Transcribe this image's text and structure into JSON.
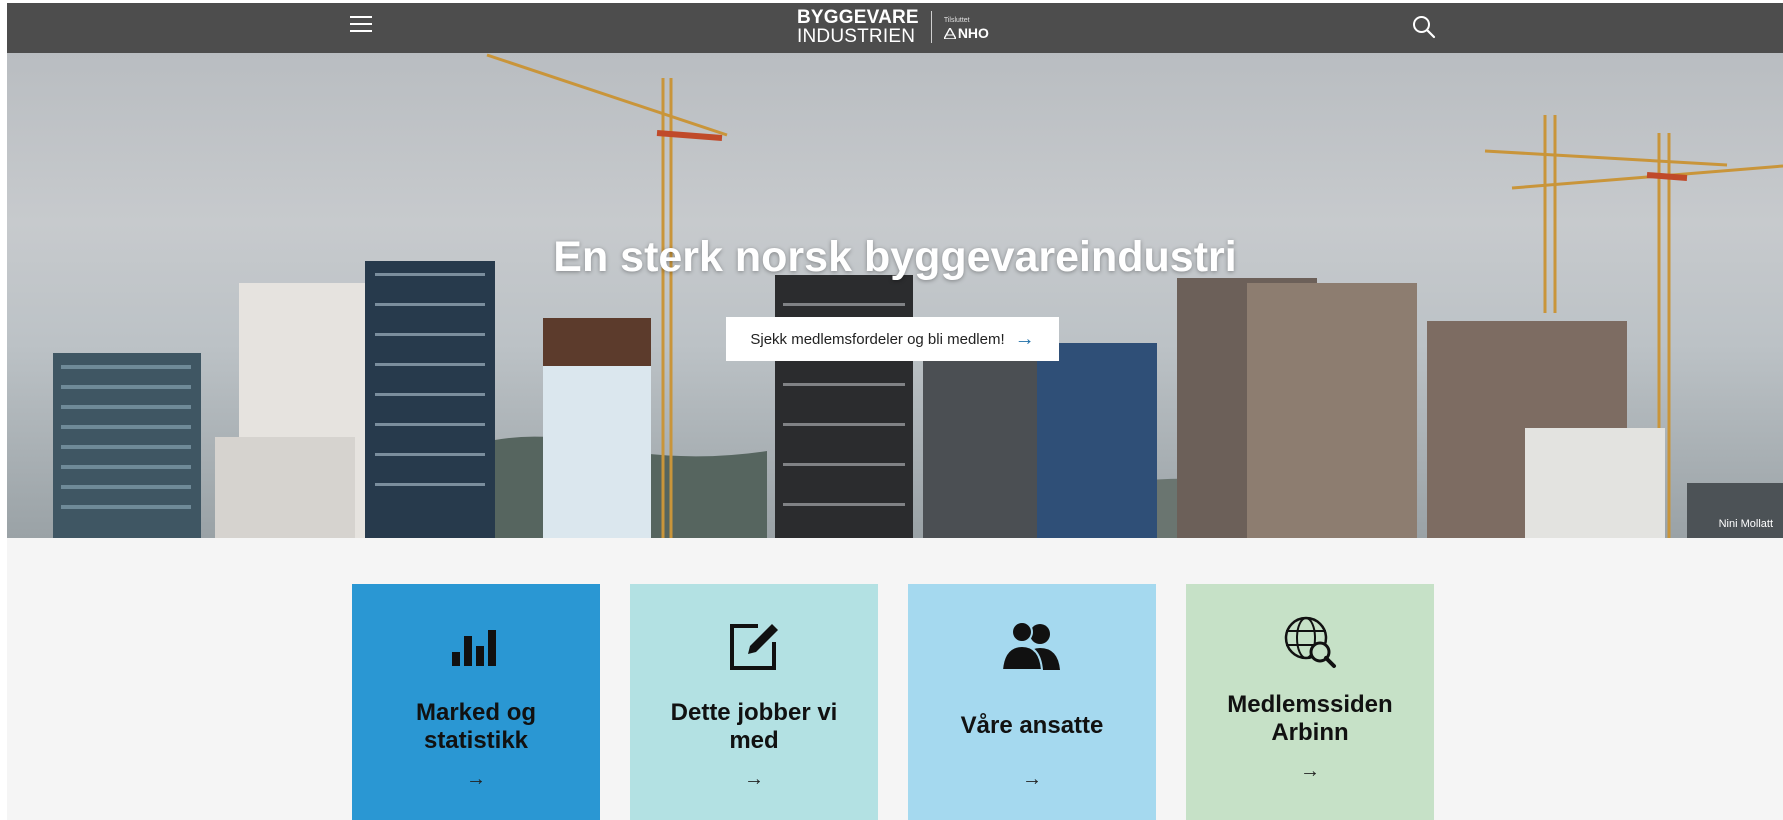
{
  "header": {
    "logo_line1": "BYGGEVARE",
    "logo_line2": "INDUSTRIEN",
    "affiliation_small": "Tilsluttet",
    "affiliation_org": "NHO",
    "menu_icon": "hamburger-icon",
    "search_icon": "search-icon"
  },
  "hero": {
    "title": "En sterk norsk byggevareindustri",
    "cta_label": "Sjekk medlemsfordeler og bli medlem!",
    "photo_credit": "Nini Mollatt"
  },
  "cards": [
    {
      "label": "Marked og statistikk",
      "icon": "bar-chart-icon",
      "color": "#2a97d3"
    },
    {
      "label": "Dette jobber vi med",
      "icon": "edit-icon",
      "color": "#b3e1e3"
    },
    {
      "label": "Våre ansatte",
      "icon": "people-icon",
      "color": "#a5d9ef"
    },
    {
      "label": "Medlemssiden Arbinn",
      "icon": "globe-search-icon",
      "color": "#c6e1c7"
    }
  ]
}
